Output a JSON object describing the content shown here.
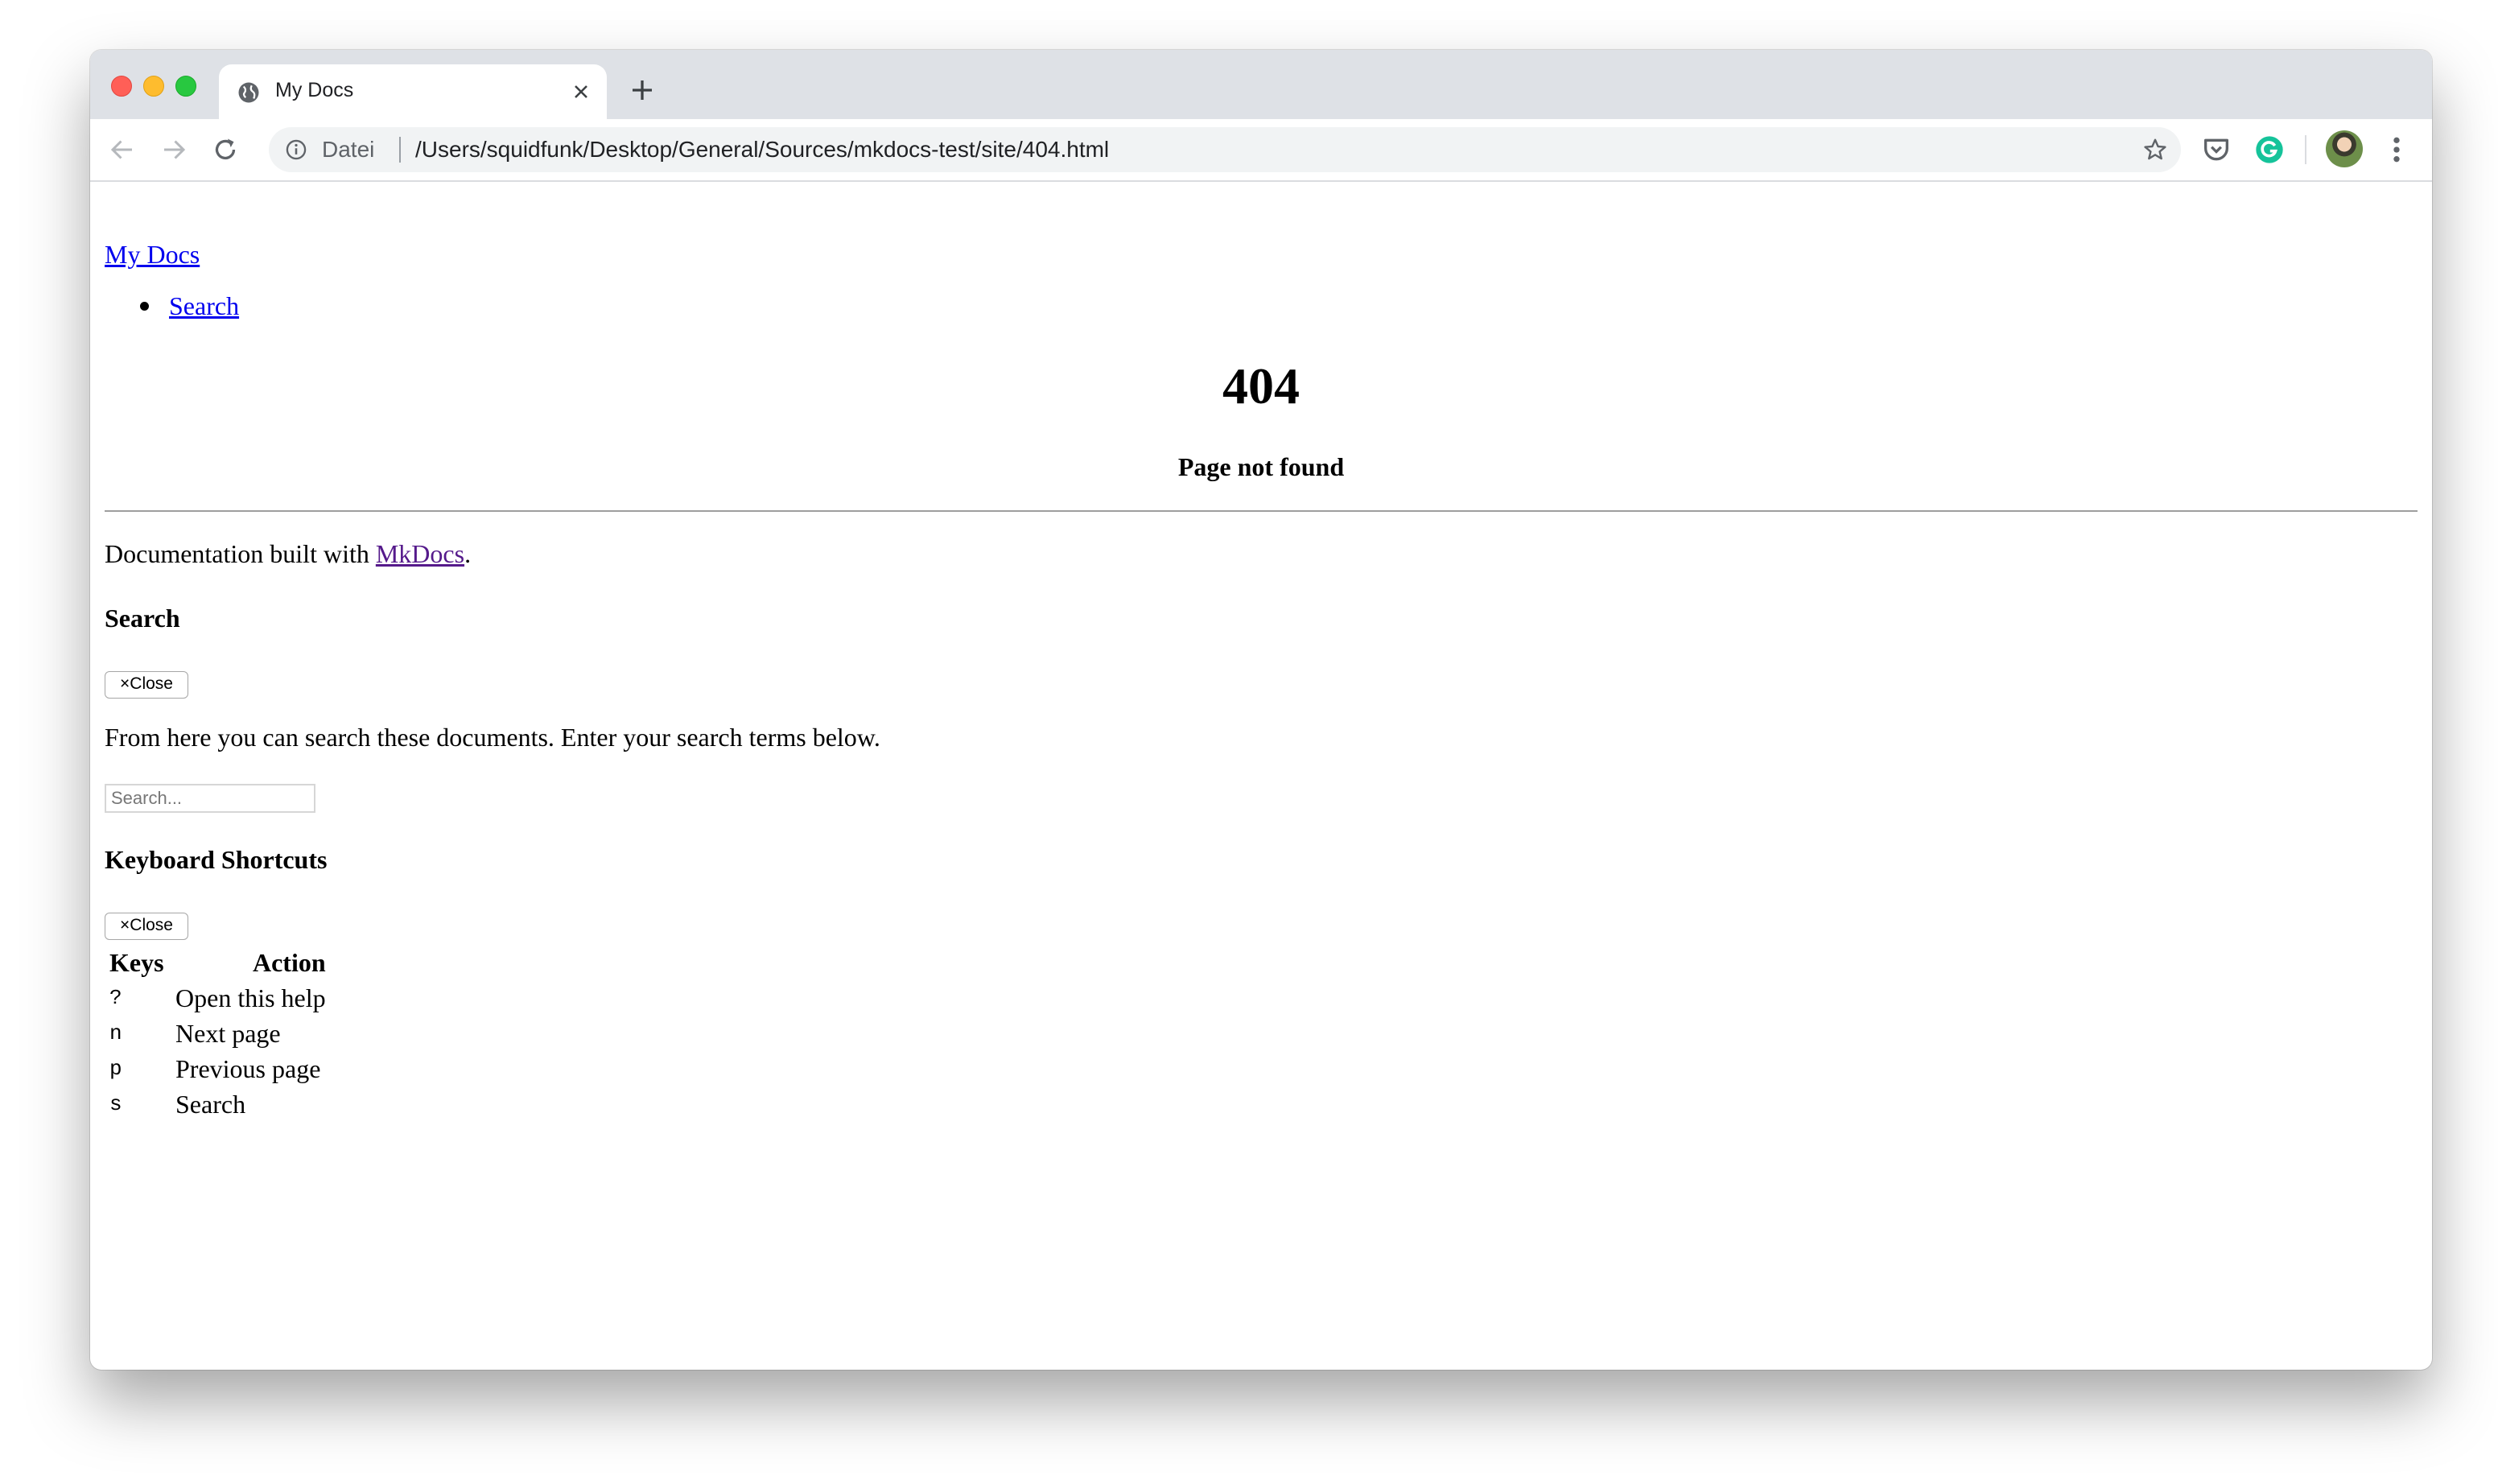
{
  "browser": {
    "tab_title": "My Docs",
    "url_scheme_label": "Datei",
    "url": "/Users/squidfunk/Desktop/General/Sources/mkdocs-test/site/404.html"
  },
  "page": {
    "brand": "My Docs",
    "nav": [
      {
        "label": "Search"
      }
    ],
    "heading": "404",
    "subheading": "Page not found",
    "footer": {
      "prefix": "Documentation built with ",
      "link": "MkDocs",
      "suffix": "."
    },
    "search_modal": {
      "title": "Search",
      "close_label": "×Close",
      "description": "From here you can search these documents. Enter your search terms below.",
      "input_placeholder": "Search..."
    },
    "keyboard_modal": {
      "title": "Keyboard Shortcuts",
      "close_label": "×Close",
      "columns": [
        "Keys",
        "Action"
      ],
      "rows": [
        {
          "key": "?",
          "action": "Open this help"
        },
        {
          "key": "n",
          "action": "Next page"
        },
        {
          "key": "p",
          "action": "Previous page"
        },
        {
          "key": "s",
          "action": "Search"
        }
      ]
    }
  },
  "colors": {
    "link": "#0000ee",
    "visited_link": "#551a8b",
    "tabstrip": "#dee1e6",
    "omnibox": "#f1f3f4"
  }
}
